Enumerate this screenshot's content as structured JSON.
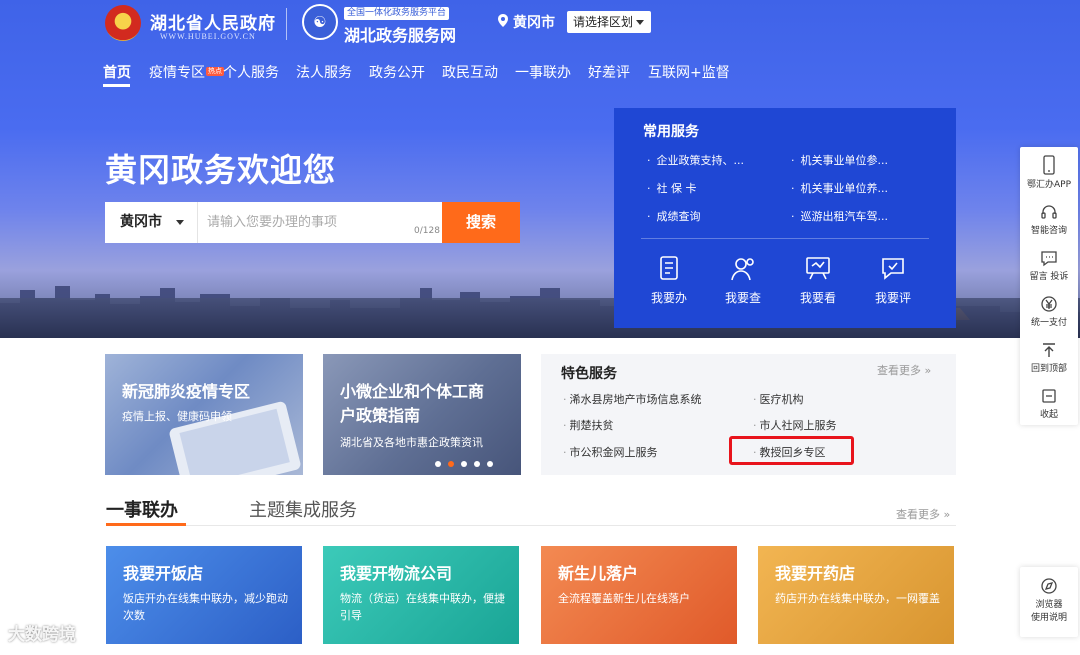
{
  "header": {
    "gov_title": "湖北省人民政府",
    "gov_site": "WWW.HUBEI.GOV.CN",
    "platform_badge": "全国一体化政务服务平台",
    "platform_title": "湖北政务服务网",
    "city": "黄冈市",
    "region_select": "请选择区划"
  },
  "nav": {
    "items": [
      "首页",
      "疫情专区",
      "个人服务",
      "法人服务",
      "政务公开",
      "政民互动",
      "一事联办",
      "好差评",
      "互联网+监督"
    ],
    "hot_badge": "热点"
  },
  "hero": {
    "welcome": "黄冈政务欢迎您",
    "search_city": "黄冈市",
    "search_placeholder": "请输入您要办理的事项",
    "search_count": "0/128",
    "search_button": "搜索"
  },
  "common_services": {
    "title": "常用服务",
    "links": [
      "企业政策支持、...",
      "机关事业单位参...",
      "社 保 卡",
      "机关事业单位养...",
      "成绩查询",
      "巡游出租汽车驾..."
    ],
    "quick": [
      "我要办",
      "我要查",
      "我要看",
      "我要评"
    ]
  },
  "sidebar": {
    "items": [
      "鄂汇办APP",
      "智能咨询",
      "留言 投诉",
      "统一支付",
      "回到顶部",
      "收起"
    ],
    "browser": [
      "浏览器",
      "使用说明"
    ]
  },
  "banners": [
    {
      "title": "新冠肺炎疫情专区",
      "sub": "疫情上报、健康码申领"
    },
    {
      "title_line1": "小微企业和个体工商",
      "title_line2": "户政策指南",
      "sub": "湖北省及各地市惠企政策资讯"
    }
  ],
  "featured": {
    "title": "特色服务",
    "more": "查看更多 »",
    "links": [
      "浠水县房地产市场信息系统",
      "医疗机构",
      "荆楚扶贫",
      "市人社网上服务",
      "市公积金网上服务",
      "教授回乡专区"
    ]
  },
  "tabs": {
    "tab1": "一事联办",
    "tab2": "主题集成服务",
    "more": "查看更多 »"
  },
  "cards": [
    {
      "title": "我要开饭店",
      "desc": "饭店开办在线集中联办，减少跑动次数",
      "color1": "#3b7fe0",
      "color2": "#2a5fc8"
    },
    {
      "title": "我要开物流公司",
      "desc": "物流（货运）在线集中联办，便捷引导",
      "color1": "#2fc0b0",
      "color2": "#1aa596"
    },
    {
      "title": "新生儿落户",
      "desc": "全流程覆盖新生儿在线落户",
      "color1": "#f07a4a",
      "color2": "#e05a2a"
    },
    {
      "title": "我要开药店",
      "desc": "药店开办在线集中联办，一网覆盖",
      "color1": "#f0b04a",
      "color2": "#d89530"
    }
  ],
  "watermark": "大数跨境"
}
